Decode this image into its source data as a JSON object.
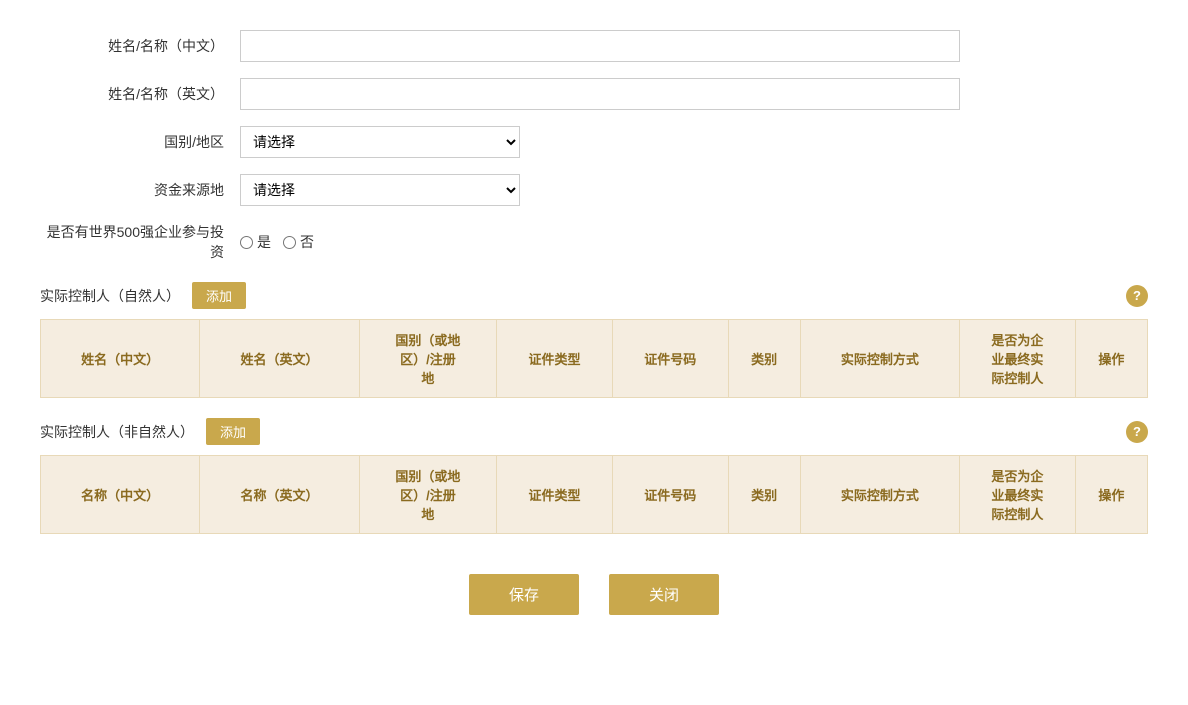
{
  "form": {
    "name_cn_label": "姓名/名称（中文）",
    "name_en_label": "姓名/名称（英文）",
    "country_label": "国别/地区",
    "country_placeholder": "请选择",
    "fund_source_label": "资金来源地",
    "fund_source_placeholder": "请选择",
    "fortune500_label": "是否有世界500强企业参与投资",
    "yes_label": "是",
    "no_label": "否",
    "name_cn_value": "",
    "name_en_value": ""
  },
  "section1": {
    "title": "实际控制人（自然人）",
    "add_label": "添加",
    "columns": [
      "姓名（中文）",
      "姓名（英文）",
      "国别（或地\n区）/注册\n地",
      "证件类型",
      "证件号码",
      "类别",
      "实际控制方式",
      "是否为企\n业最终实\n际控制人",
      "操作"
    ]
  },
  "section2": {
    "title": "实际控制人（非自然人）",
    "add_label": "添加",
    "columns": [
      "名称（中文）",
      "名称（英文）",
      "国别（或地\n区）/注册\n地",
      "证件类型",
      "证件号码",
      "类别",
      "实际控制方式",
      "是否为企\n业最终实\n际控制人",
      "操作"
    ]
  },
  "buttons": {
    "save": "保存",
    "close": "关闭"
  },
  "icons": {
    "help": "?",
    "add": "添加"
  }
}
